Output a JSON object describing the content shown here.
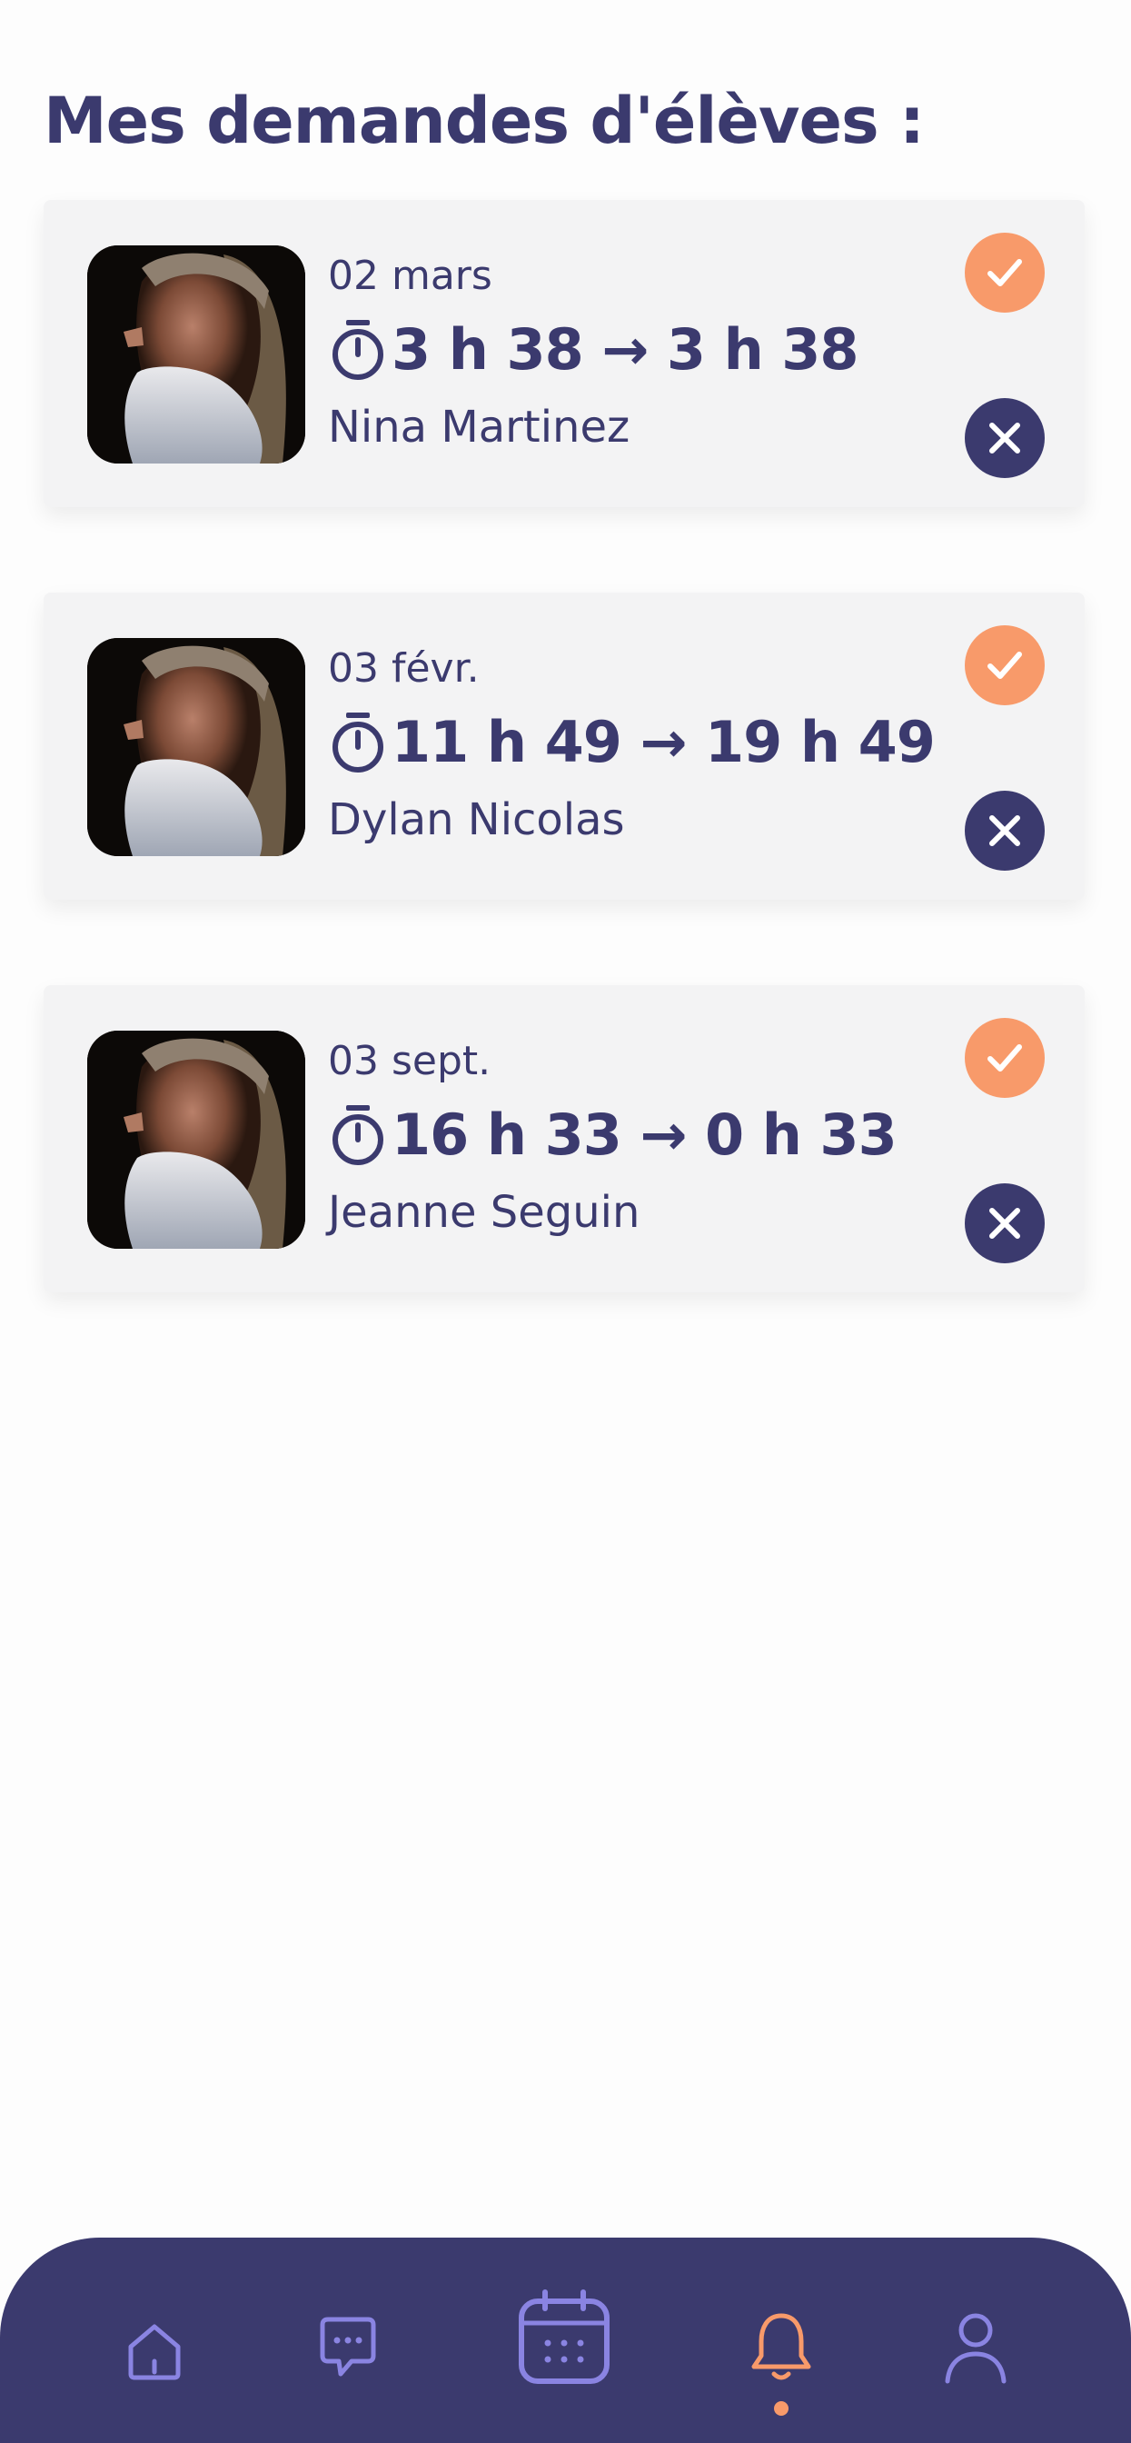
{
  "header": {
    "title": "Mes demandes d'élèves :"
  },
  "requests": [
    {
      "date": "02 mars",
      "time_range": "3 h 38 → 3 h 38",
      "student": "Nina Martinez"
    },
    {
      "date": "03 févr.",
      "time_range": "11 h 49 → 19 h 49",
      "student": "Dylan Nicolas"
    },
    {
      "date": "03 sept.",
      "time_range": "16 h 33 → 0 h 33",
      "student": "Jeanne Seguin"
    }
  ],
  "icons": {
    "timer": "timer-icon",
    "accept": "check-icon",
    "decline": "close-icon",
    "nav": [
      "home-icon",
      "chat-icon",
      "calendar-icon",
      "bell-icon",
      "profile-icon"
    ]
  },
  "nav": {
    "active": "notifications"
  },
  "colors": {
    "primary": "#3b3a6e",
    "accent": "#f89a6a",
    "nav_icon": "#8a84e2",
    "card_bg": "#f3f3f4"
  }
}
